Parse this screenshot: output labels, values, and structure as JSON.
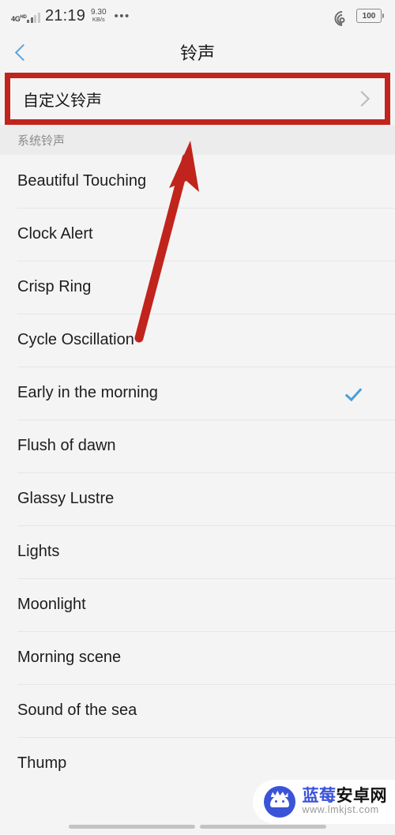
{
  "status_bar": {
    "network_type": "4G",
    "network_type_sup": "HD",
    "time": "21:19",
    "net_speed_value": "9.30",
    "net_speed_unit": "KB/s",
    "overflow_dots": "•••",
    "wifi_icon": "wifi-icon",
    "battery_level": "100"
  },
  "title_bar": {
    "back_icon": "chevron-left-icon",
    "title": "铃声"
  },
  "custom_row": {
    "label": "自定义铃声",
    "chevron_icon": "chevron-right-icon",
    "highlight_color": "#c0241c"
  },
  "section": {
    "header": "系统铃声"
  },
  "ringtones": [
    {
      "name": "Beautiful Touching",
      "selected": false
    },
    {
      "name": "Clock Alert",
      "selected": false
    },
    {
      "name": "Crisp Ring",
      "selected": false
    },
    {
      "name": "Cycle Oscillation",
      "selected": false
    },
    {
      "name": "Early in the morning",
      "selected": true
    },
    {
      "name": "Flush of dawn",
      "selected": false
    },
    {
      "name": "Glassy Lustre",
      "selected": false
    },
    {
      "name": "Lights",
      "selected": false
    },
    {
      "name": "Moonlight",
      "selected": false
    },
    {
      "name": "Morning scene",
      "selected": false
    },
    {
      "name": "Sound of the sea",
      "selected": false
    },
    {
      "name": "Thump",
      "selected": false
    }
  ],
  "annotation": {
    "arrow_color": "#c0241c",
    "arrow_name": "red-pointer-arrow"
  },
  "watermark": {
    "brand_blue": "蓝莓",
    "brand_black": "安卓网",
    "url": "www.lmkjst.com",
    "accent_color": "#3b53d8"
  },
  "colors": {
    "check_blue": "#4a9fd8",
    "back_blue": "#56a5dd",
    "list_bg": "#f4f4f4",
    "section_bg": "#ececec"
  }
}
